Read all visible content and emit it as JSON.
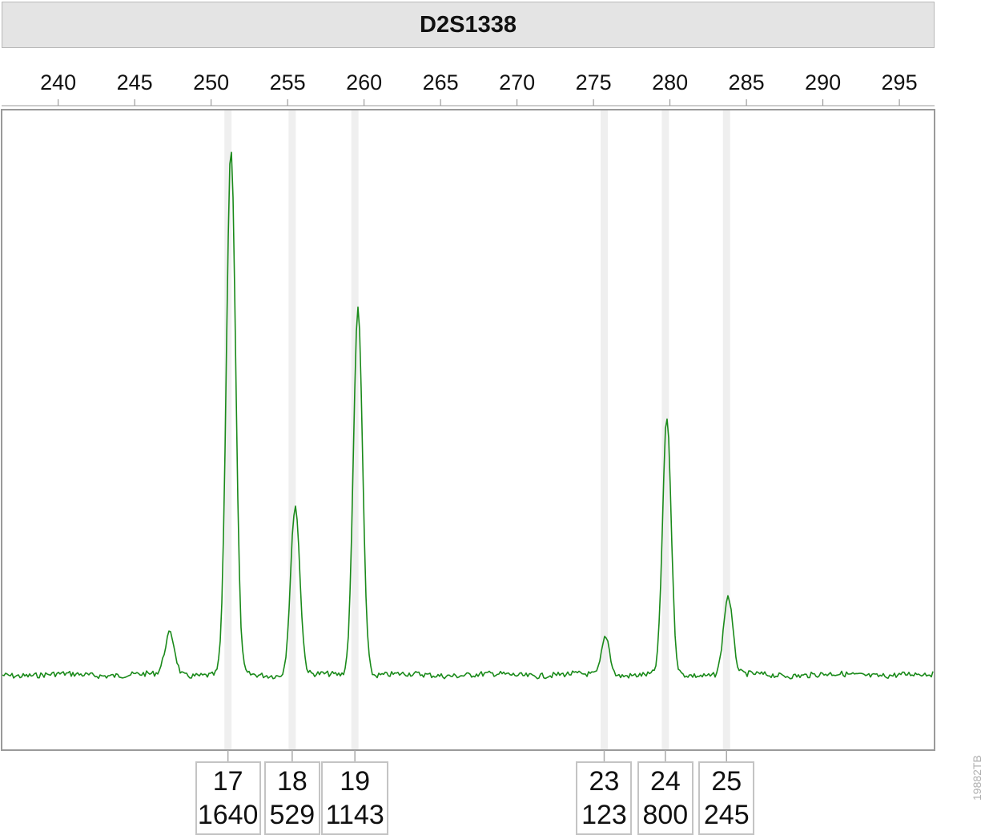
{
  "figure_code": "19882TB",
  "chart_data": {
    "type": "line",
    "title": "D2S1338",
    "xlabel": "",
    "ylabel": "",
    "xlim": [
      236.3,
      297.3
    ],
    "x_ticks": [
      240,
      245,
      250,
      255,
      260,
      265,
      270,
      275,
      280,
      285,
      290,
      295
    ],
    "grid": false,
    "series_color": "#1a8a1a",
    "bin_color": "#efefef",
    "baseline_rfu": 0,
    "y_max_rfu": 2070,
    "peaks": [
      {
        "x": 247.3,
        "height_rfu": 130,
        "sigma": 0.32,
        "called": false
      },
      {
        "x": 251.3,
        "height_rfu": 1640,
        "sigma": 0.3,
        "called": true
      },
      {
        "x": 255.5,
        "height_rfu": 529,
        "sigma": 0.3,
        "called": true
      },
      {
        "x": 259.6,
        "height_rfu": 1143,
        "sigma": 0.3,
        "called": true
      },
      {
        "x": 275.8,
        "height_rfu": 123,
        "sigma": 0.26,
        "called": true
      },
      {
        "x": 279.8,
        "height_rfu": 800,
        "sigma": 0.28,
        "called": true
      },
      {
        "x": 283.8,
        "height_rfu": 245,
        "sigma": 0.3,
        "called": true
      }
    ],
    "alleles": [
      {
        "allele": "17",
        "rfu": "1640",
        "bin_x": 251.1
      },
      {
        "allele": "18",
        "rfu": "529",
        "bin_x": 255.3
      },
      {
        "allele": "19",
        "rfu": "1143",
        "bin_x": 259.4
      },
      {
        "allele": "23",
        "rfu": "123",
        "bin_x": 275.7
      },
      {
        "allele": "24",
        "rfu": "800",
        "bin_x": 279.7
      },
      {
        "allele": "25",
        "rfu": "245",
        "bin_x": 283.7
      }
    ]
  }
}
